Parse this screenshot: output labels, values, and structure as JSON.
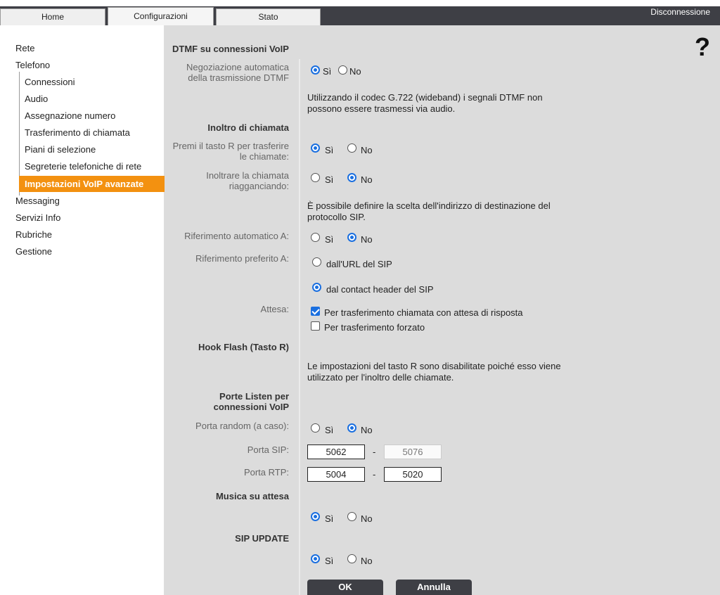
{
  "tabs": [
    {
      "label": "Home"
    },
    {
      "label": "Configurazioni"
    },
    {
      "label": "Stato"
    }
  ],
  "logout_label": "Disconnessione",
  "help_symbol": "?",
  "sidebar": {
    "rete": "Rete",
    "telefono": "Telefono",
    "sub": [
      "Connessioni",
      "Audio",
      "Assegnazione numero",
      "Trasferimento di chiamata",
      "Piani di selezione",
      "Segreterie telefoniche di rete",
      "Impostazioni VoIP avanzate"
    ],
    "messaging": "Messaging",
    "servizi": "Servizi Info",
    "rubriche": "Rubriche",
    "gestione": "Gestione"
  },
  "main": {
    "dtmf_title": "DTMF su connessioni VoIP",
    "dtmf_label_1": "Negoziazione automatica",
    "dtmf_label_2": "della trasmissione DTMF",
    "dtmf_note": "Utilizzando il codec G.722 (wideband) i segnali DTMF non possono essere trasmessi via audio.",
    "forward_title": "Inoltro di chiamata",
    "r_key_label_1": "Premi il tasto R per trasferire",
    "r_key_label_2": "le chiamate:",
    "hangup_label_1": "Inoltrare la chiamata",
    "hangup_label_2": "riagganciando:",
    "sip_note": "È possibile definire la scelta dell'indirizzo di destinazione del protocollo SIP.",
    "auto_ref_label": "Riferimento automatico A:",
    "pref_ref_label": "Riferimento preferito A:",
    "pref_opt_url": "dall'URL del SIP",
    "pref_opt_contact": "dal contact header del SIP",
    "hold_label": "Attesa:",
    "hold_opt_1": "Per trasferimento chiamata con attesa di risposta",
    "hold_opt_2": "Per trasferimento forzato",
    "hookflash_title": "Hook Flash (Tasto R)",
    "hookflash_note": "Le impostazioni del tasto R sono disabilitate poiché esso viene utilizzato per l'inoltro delle chiamate.",
    "ports_title_1": "Porte Listen per",
    "ports_title_2": "connessioni VoIP",
    "random_port_label": "Porta random (a caso):",
    "sip_port_label": "Porta SIP:",
    "sip_port_from": "5062",
    "sip_port_to": "5076",
    "rtp_port_label": "Porta RTP:",
    "rtp_port_from": "5004",
    "rtp_port_to": "5020",
    "music_title": "Musica su attesa",
    "sipupdate_title": "SIP UPDATE",
    "yes": "Sì",
    "no": "No",
    "dash": "-",
    "ok_label": "OK",
    "cancel_label": "Annulla"
  },
  "colors": {
    "accent": "#f39110",
    "topbar": "#3e3f45",
    "radio": "#1a6fe0"
  }
}
